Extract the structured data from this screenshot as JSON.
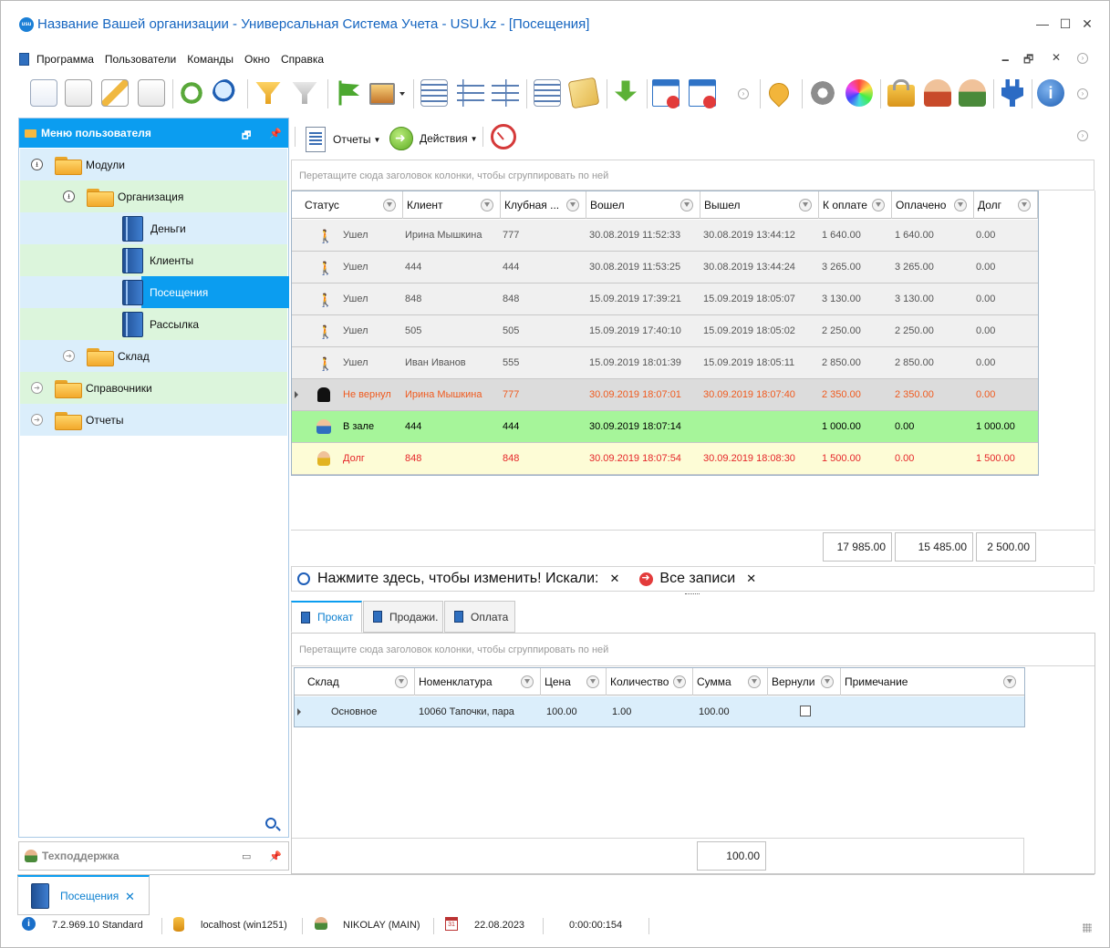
{
  "window": {
    "logo_text": "usu",
    "title": "Название Вашей организации - Универсальная Система Учета - USU.kz - [Посещения]",
    "min": "—",
    "max": "☐",
    "close": "✕"
  },
  "menu": {
    "items": [
      "Программа",
      "Пользователи",
      "Команды",
      "Окно",
      "Справка"
    ],
    "mdi_min": "🗕",
    "mdi_restore": "🗗",
    "mdi_close": "✕"
  },
  "left_panel": {
    "title": "Меню пользователя",
    "tree": [
      {
        "label": "Модули",
        "level": 0,
        "type": "folder",
        "expanded": true
      },
      {
        "label": "Организация",
        "level": 1,
        "type": "folder",
        "expanded": true
      },
      {
        "label": "Деньги",
        "level": 2,
        "type": "book"
      },
      {
        "label": "Клиенты",
        "level": 2,
        "type": "book"
      },
      {
        "label": "Посещения",
        "level": 2,
        "type": "book",
        "selected": true
      },
      {
        "label": "Рассылка",
        "level": 2,
        "type": "book"
      },
      {
        "label": "Склад",
        "level": 1,
        "type": "folder",
        "expanded": false
      },
      {
        "label": "Справочники",
        "level": 0,
        "type": "folder",
        "expanded": false
      },
      {
        "label": "Отчеты",
        "level": 0,
        "type": "folder",
        "expanded": false
      }
    ]
  },
  "support": {
    "label": "Техподдержка"
  },
  "right_toolbar": {
    "reports": "Отчеты",
    "actions": "Действия"
  },
  "main_grid": {
    "group_hint": "Перетащите сюда заголовок колонки, чтобы сгруппировать по ней",
    "columns": [
      "Статус",
      "Клиент",
      "Клубная ...",
      "Вошел",
      "Вышел",
      "К оплате",
      "Оплачено",
      "Долг"
    ],
    "rows": [
      {
        "status": "Ушел",
        "client": "Ирина Мышкина",
        "card": "777",
        "in": "30.08.2019 11:52:33",
        "out": "30.08.2019 13:44:12",
        "to_pay": "1 640.00",
        "paid": "1 640.00",
        "debt": "0.00",
        "kind": "left"
      },
      {
        "status": "Ушел",
        "client": "444",
        "card": "444",
        "in": "30.08.2019 11:53:25",
        "out": "30.08.2019 13:44:24",
        "to_pay": "3 265.00",
        "paid": "3 265.00",
        "debt": "0.00",
        "kind": "left"
      },
      {
        "status": "Ушел",
        "client": "848",
        "card": "848",
        "in": "15.09.2019 17:39:21",
        "out": "15.09.2019 18:05:07",
        "to_pay": "3 130.00",
        "paid": "3 130.00",
        "debt": "0.00",
        "kind": "left"
      },
      {
        "status": "Ушел",
        "client": "505",
        "card": "505",
        "in": "15.09.2019 17:40:10",
        "out": "15.09.2019 18:05:02",
        "to_pay": "2 250.00",
        "paid": "2 250.00",
        "debt": "0.00",
        "kind": "left"
      },
      {
        "status": "Ушел",
        "client": "Иван Иванов",
        "card": "555",
        "in": "15.09.2019 18:01:39",
        "out": "15.09.2019 18:05:11",
        "to_pay": "2 850.00",
        "paid": "2 850.00",
        "debt": "0.00",
        "kind": "left"
      },
      {
        "status": "Не вернул",
        "client": "Ирина Мышкина",
        "card": "777",
        "in": "30.09.2019 18:07:01",
        "out": "30.09.2019 18:07:40",
        "to_pay": "2 350.00",
        "paid": "2 350.00",
        "debt": "0.00",
        "kind": "notreturned"
      },
      {
        "status": "В зале",
        "client": "444",
        "card": "444",
        "in": "30.09.2019 18:07:14",
        "out": "",
        "to_pay": "1 000.00",
        "paid": "0.00",
        "debt": "1 000.00",
        "kind": "inhall"
      },
      {
        "status": "Долг",
        "client": "848",
        "card": "848",
        "in": "30.09.2019 18:07:54",
        "out": "30.09.2019 18:08:30",
        "to_pay": "1 500.00",
        "paid": "0.00",
        "debt": "1 500.00",
        "kind": "debt"
      }
    ],
    "totals": {
      "to_pay": "17 985.00",
      "paid": "15 485.00",
      "debt": "2 500.00"
    }
  },
  "filter_bar": {
    "text": "Нажмите здесь, чтобы изменить! Искали:",
    "x1": "✕",
    "all": "Все записи",
    "x2": "✕"
  },
  "detail": {
    "tabs": [
      "Прокат",
      "Продажи.",
      "Оплата"
    ],
    "group_hint": "Перетащите сюда заголовок колонки, чтобы сгруппировать по ней",
    "columns": [
      "Склад",
      "Номенклатура",
      "Цена",
      "Количество",
      "Сумма",
      "Вернули",
      "Примечание"
    ],
    "rows": [
      {
        "warehouse": "Основное",
        "item": "10060 Тапочки, пара",
        "price": "100.00",
        "qty": "1.00",
        "sum": "100.00",
        "returned": false,
        "note": ""
      }
    ],
    "total_sum": "100.00"
  },
  "doc_tab": {
    "label": "Посещения",
    "close": "✕"
  },
  "status_bar": {
    "version": "7.2.969.10 Standard",
    "server": "localhost (win1251)",
    "user": "NIKOLAY (MAIN)",
    "calendar_day": "31",
    "date": "22.08.2023",
    "timer": "0:00:00:154"
  },
  "colors": {
    "accent": "#0b9df0",
    "title_blue": "#1565c0",
    "tree_blue": "#dbeefb",
    "tree_green": "#dcf5dc",
    "row_grey": "#f0f0f0",
    "row_notreturned": "#dcdcdc",
    "row_inhall": "#a6f59a",
    "row_debt": "#fdfcd6",
    "text_orange": "#f05a1e",
    "text_red": "#e5262a"
  }
}
